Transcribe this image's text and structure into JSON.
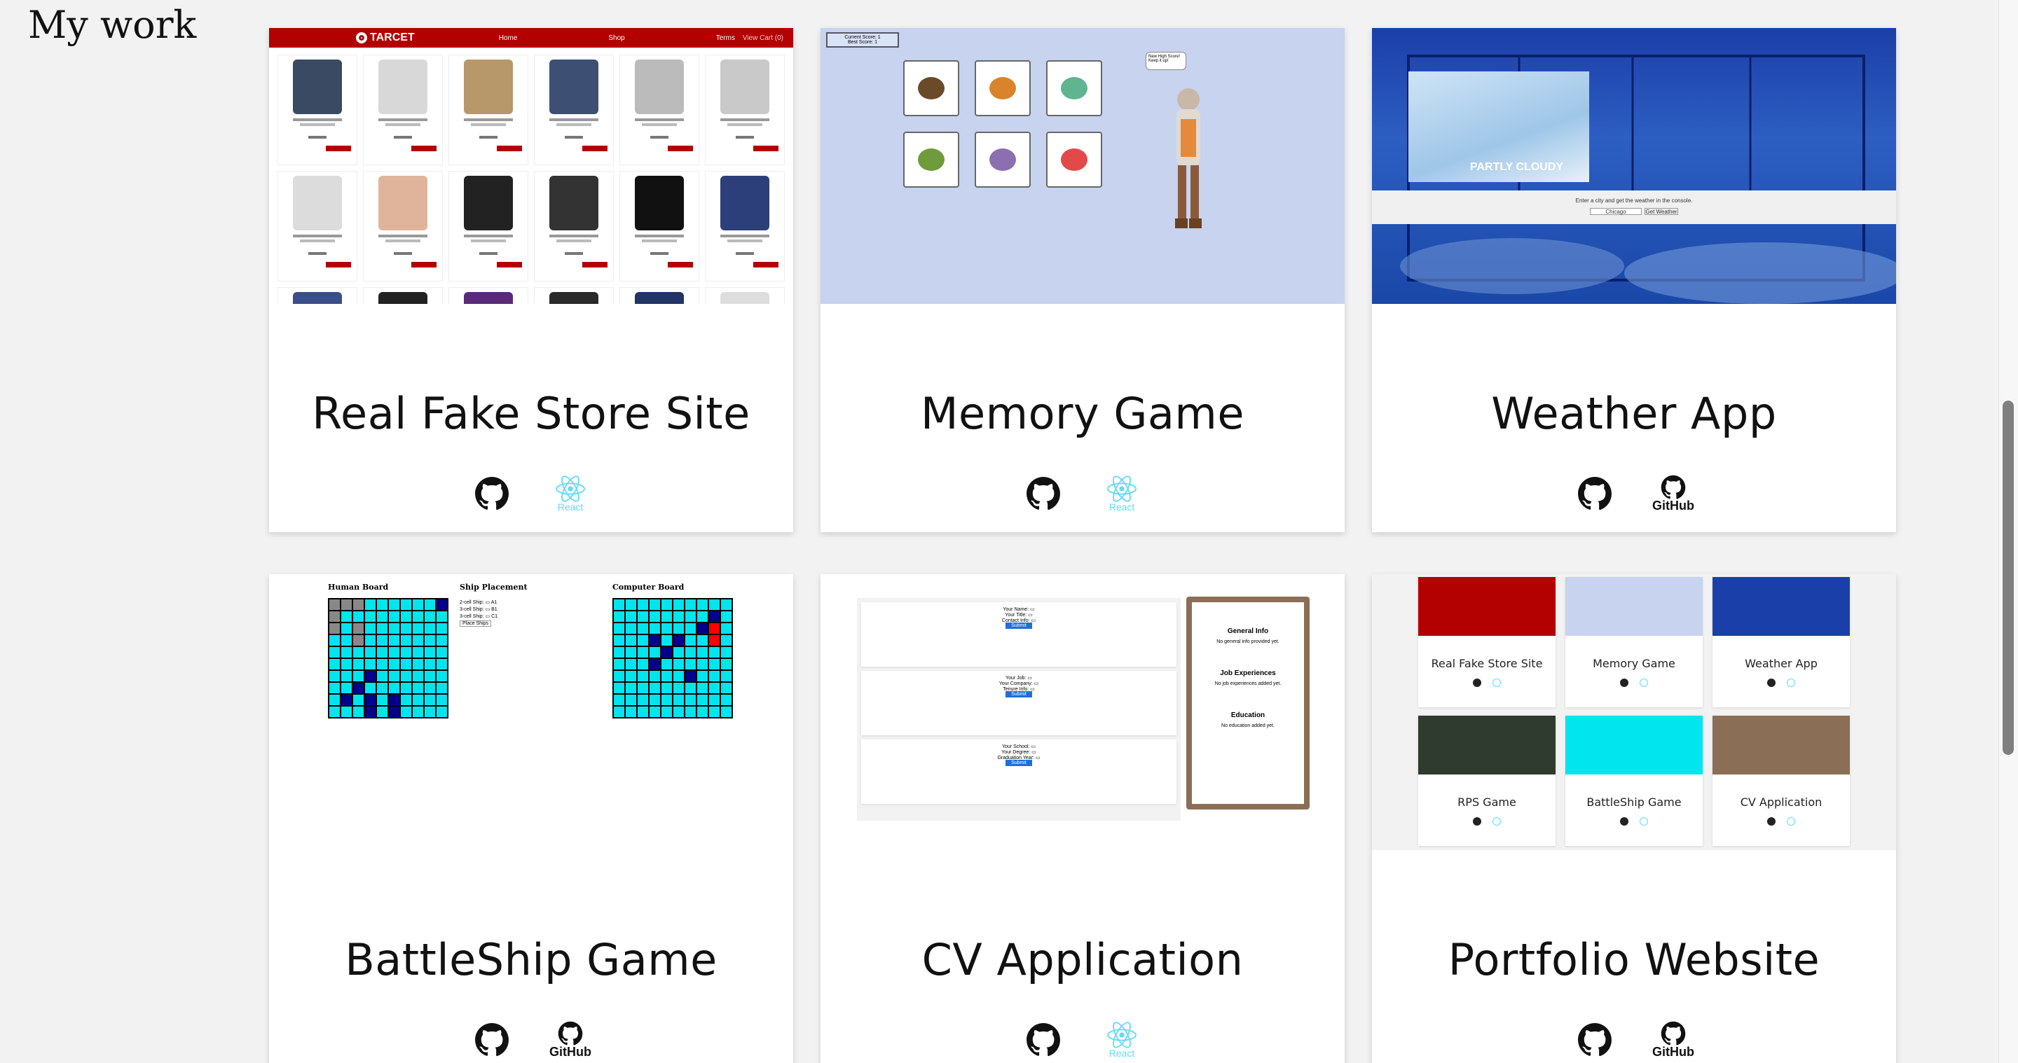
{
  "section": {
    "title": "My work"
  },
  "projects": [
    {
      "title": "Real Fake Store Site",
      "links": [
        {
          "icon": "github-icon"
        },
        {
          "icon": "react-icon",
          "label": "React"
        }
      ],
      "preview": {
        "brand": "TARCET",
        "nav": [
          "Home",
          "Shop",
          "Terms"
        ],
        "cart": "View Cart (0)"
      }
    },
    {
      "title": "Memory Game",
      "links": [
        {
          "icon": "github-icon"
        },
        {
          "icon": "react-icon",
          "label": "React"
        }
      ],
      "preview": {
        "score": "Current Score: 1",
        "best": "Best Score: 1",
        "speech": "New High Score! Keep it up!"
      }
    },
    {
      "title": "Weather App",
      "links": [
        {
          "icon": "github-icon"
        },
        {
          "icon": "github-pages-icon",
          "label": "GitHub"
        }
      ],
      "preview": {
        "condition": "PARTLY CLOUDY",
        "prompt": "Enter a city and get the weather in the console.",
        "input": "Chicago",
        "button": "Get Weather"
      }
    },
    {
      "title": "BattleShip Game",
      "links": [
        {
          "icon": "github-icon"
        },
        {
          "icon": "github-pages-icon",
          "label": "GitHub"
        }
      ],
      "preview": {
        "human": "Human Board",
        "placement": "Ship Placement",
        "computer": "Computer Board",
        "place": "Place Ships"
      }
    },
    {
      "title": "CV Application",
      "links": [
        {
          "icon": "github-icon"
        },
        {
          "icon": "react-icon",
          "label": "React"
        }
      ],
      "preview": {
        "general": "General Info",
        "general_empty": "No general info provided yet.",
        "jobs": "Job Experiences",
        "jobs_empty": "No job experiences added yet.",
        "edu": "Education",
        "edu_empty": "No education added yet.",
        "submit": "Submit"
      }
    },
    {
      "title": "Portfolio Website",
      "links": [
        {
          "icon": "github-icon"
        },
        {
          "icon": "github-pages-icon",
          "label": "GitHub"
        }
      ],
      "preview": {
        "cards": [
          "Real Fake Store Site",
          "Memory Game",
          "Weather App",
          "RPS Game",
          "BattleShip Game",
          "CV Application"
        ]
      }
    }
  ]
}
